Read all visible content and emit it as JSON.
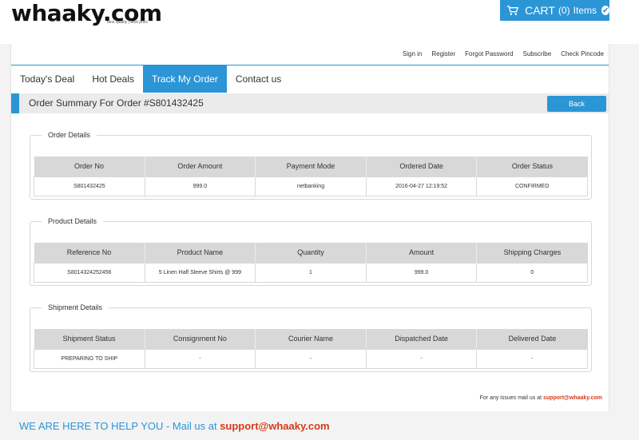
{
  "brand": {
    "logo_text": "whaaky.com",
    "tagline": "best quality | best price"
  },
  "cart": {
    "label": "CART",
    "count": "(0)",
    "items_label": "Items",
    "check_glyph": "✔",
    "icon": "shopping-cart-icon"
  },
  "toplinks": [
    "Sign in",
    "Register",
    "Forgot Password",
    "Subscribe",
    "Check Pincode"
  ],
  "nav": {
    "tabs": [
      "Today's Deal",
      "Hot Deals",
      "Track My Order",
      "Contact us"
    ],
    "active_index": 2
  },
  "summary": {
    "title": "Order Summary For Order #S801432425",
    "back_label": "Back"
  },
  "order_details": {
    "legend": "Order Details",
    "headers": [
      "Order No",
      "Order Amount",
      "Payment Mode",
      "Ordered Date",
      "Order Status"
    ],
    "row": [
      "S801432425",
      "999.0",
      "netbanking",
      "2016-04-27 12:19:52",
      "CONFIRMED"
    ]
  },
  "product_details": {
    "legend": "Product Details",
    "headers": [
      "Reference No",
      "Product Name",
      "Quantity",
      "Amount",
      "Shipping Charges"
    ],
    "row": [
      "S8014324252456",
      "5 Linen Half Sleeve Shirts @ 999",
      "1",
      "999.0",
      "0"
    ]
  },
  "shipment_details": {
    "legend": "Shipment Details",
    "headers": [
      "Shipment Status",
      "Consignment No",
      "Courier Name",
      "Dispatched Date",
      "Delivered Date"
    ],
    "row": [
      "PREPARING TO SHIP",
      "-",
      "-",
      "-",
      "-"
    ]
  },
  "issues": {
    "text": "For any issues mail us at ",
    "email": "support@whaaky.com"
  },
  "footer": {
    "text": "WE ARE HERE TO HELP YOU - Mail us at ",
    "email": "support@whaaky.com"
  },
  "colors": {
    "accent": "#2b95d6",
    "email": "#d63a18"
  }
}
